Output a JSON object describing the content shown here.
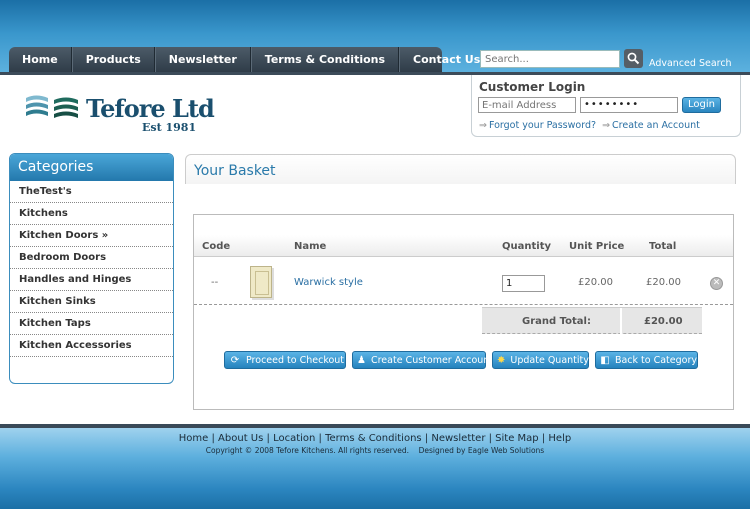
{
  "nav": {
    "items": [
      "Home",
      "Products",
      "Newsletter",
      "Terms & Conditions",
      "Contact Us"
    ]
  },
  "search": {
    "placeholder": "Search...",
    "advanced_label": "Advanced Search"
  },
  "logo": {
    "name": "Tefore Ltd",
    "est": "Est 1981"
  },
  "login": {
    "title": "Customer Login",
    "email_placeholder": "E-mail Address",
    "password_value": "••••••••",
    "button_label": "Login",
    "forgot_label": "Forgot your Password?",
    "create_label": "Create an Account"
  },
  "categories": {
    "title": "Categories",
    "items": [
      "TheTest's",
      "Kitchens",
      "Kitchen Doors »",
      "Bedroom Doors",
      "Handles and Hinges",
      "Kitchen Sinks",
      "Kitchen Taps",
      "Kitchen Accessories"
    ]
  },
  "basket": {
    "title": "Your Basket",
    "columns": [
      "Code",
      "Name",
      "Quantity",
      "Unit Price",
      "Total"
    ],
    "rows": [
      {
        "code": "--",
        "name": "Warwick style",
        "quantity": "1",
        "unit_price": "£20.00",
        "total": "£20.00"
      }
    ],
    "grand_total_label": "Grand Total:",
    "grand_total_value": "£20.00",
    "actions": [
      "Proceed to Checkout",
      "Create Customer Account",
      "Update Quantity",
      "Back to Category"
    ]
  },
  "footer": {
    "links": [
      "Home",
      "About Us",
      "Location",
      "Terms & Conditions",
      "Newsletter",
      "Site Map",
      "Help"
    ],
    "copyright": "Copyright © 2008 Tefore Kitchens. All rights reserved.",
    "credit": "Designed by Eagle Web Solutions"
  },
  "colors": {
    "brand_blue": "#2a7aaa",
    "nav_dark": "#3c4b59"
  }
}
